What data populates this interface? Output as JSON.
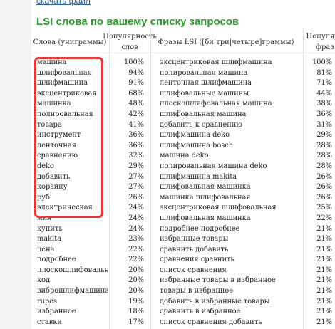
{
  "top_link": "скачать файл",
  "section_title": "LSI слова по вашему списку запросов",
  "headers": {
    "words": "Слова (униграммы)",
    "popularity": "Популярность слов",
    "phrases": "Фразы LSI ([би|три|четыре]граммы)",
    "popularity2": "Популярн фраз"
  },
  "highlight_color": "#e5393b",
  "title_color": "#2e9b2e",
  "link_color": "#2f5fb3",
  "rows": [
    {
      "word": "машина",
      "pct": "100%",
      "phrase": "эксцентриковая шлифмашина",
      "pct2": "100%"
    },
    {
      "word": "шлифовальная",
      "pct": "94%",
      "phrase": "полировальная машина",
      "pct2": "81%"
    },
    {
      "word": "шлифмашина",
      "pct": "91%",
      "phrase": "ленточная шлифмашина",
      "pct2": "71%"
    },
    {
      "word": "эксцентриковая",
      "pct": "68%",
      "phrase": "шлифовальные машины",
      "pct2": "44%"
    },
    {
      "word": "машинка",
      "pct": "48%",
      "phrase": "плоскошлифовальная машина",
      "pct2": "38%"
    },
    {
      "word": "полировальная",
      "pct": "42%",
      "phrase": "шлифовальная машина",
      "pct2": "36%"
    },
    {
      "word": "товара",
      "pct": "41%",
      "phrase": "добавить к сравнению",
      "pct2": "31%"
    },
    {
      "word": "инструмент",
      "pct": "36%",
      "phrase": "шлифмашина deko",
      "pct2": "29%"
    },
    {
      "word": "ленточная",
      "pct": "36%",
      "phrase": "шлифмашина bosch",
      "pct2": "28%"
    },
    {
      "word": "сравнению",
      "pct": "32%",
      "phrase": "машина deko",
      "pct2": "28%"
    },
    {
      "word": "deko",
      "pct": "29%",
      "phrase": "полировальная машина deko",
      "pct2": "28%"
    },
    {
      "word": "добавить",
      "pct": "27%",
      "phrase": "шлифмашина makita",
      "pct2": "26%"
    },
    {
      "word": "корзину",
      "pct": "27%",
      "phrase": "шлифовальная машинка",
      "pct2": "26%"
    },
    {
      "word": "руб",
      "pct": "26%",
      "phrase": "машинка шлифовальная",
      "pct2": "26%"
    },
    {
      "word": "электрическая",
      "pct": "24%",
      "phrase": "эксцентриковая шлифовальная",
      "pct2": "25%"
    },
    {
      "word": "мин",
      "pct": "24%",
      "phrase": "шлифовальная машинка",
      "pct2": "22%"
    },
    {
      "word": "купить",
      "pct": "24%",
      "phrase": "подробнее подробнее",
      "pct2": "21%"
    },
    {
      "word": "makita",
      "pct": "23%",
      "phrase": "избранные товары",
      "pct2": "21%"
    },
    {
      "word": "цена",
      "pct": "22%",
      "phrase": "сравнить добавить",
      "pct2": "21%"
    },
    {
      "word": "подробнее",
      "pct": "22%",
      "phrase": "сравнения сравнить",
      "pct2": "21%"
    },
    {
      "word": "плоскошлифовальная",
      "pct": "20%",
      "phrase": "список сравнения",
      "pct2": "21%"
    },
    {
      "word": "код",
      "pct": "20%",
      "phrase": "избранные товары в избранное",
      "pct2": "21%"
    },
    {
      "word": "виброшлифмашина",
      "pct": "20%",
      "phrase": "товары в избранное",
      "pct2": "21%"
    },
    {
      "word": "rupes",
      "pct": "19%",
      "phrase": "добавить в избранные товары",
      "pct2": "21%"
    },
    {
      "word": "избранное",
      "pct": "18%",
      "phrase": "сравнить в избранное",
      "pct2": "21%"
    },
    {
      "word": "ставки",
      "pct": "17%",
      "phrase": "список сравнения добавить",
      "pct2": "21%"
    }
  ]
}
